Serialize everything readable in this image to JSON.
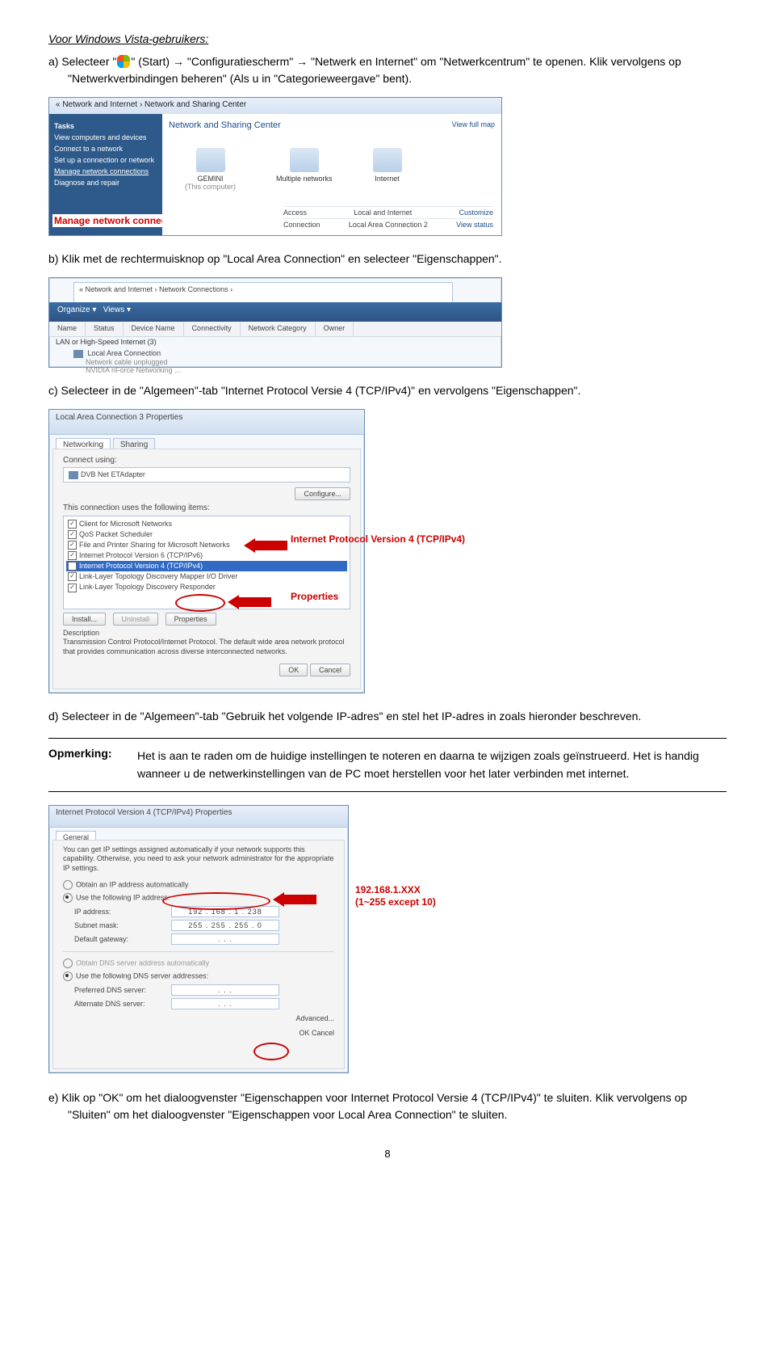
{
  "title_vista": "Voor Windows Vista-gebruikers:",
  "step_a_pre": "a)  Selecteer \"",
  "step_a_post": "\" (Start) → \"Configuratiescherm\" → \"Netwerk en Internet\" om \"Netwerkcentrum\" te openen. Klik vervolgens op \"Netwerkverbindingen beheren\" (Als u in \"Categorieweergave\" bent).",
  "step_b": "b)  Klik met de rechtermuisknop op \"Local Area Connection\" en selecteer \"Eigenschappen\".",
  "step_c": "c)  Selecteer in de \"Algemeen\"-tab \"Internet Protocol Versie 4 (TCP/IPv4)\" en vervolgens \"Eigenschappen\".",
  "step_d": "d)  Selecteer in de \"Algemeen\"-tab \"Gebruik het volgende IP-adres\" en stel het IP-adres in zoals hieronder beschreven.",
  "step_e": "e)  Klik op \"OK\" om het dialoogvenster \"Eigenschappen voor Internet Protocol Versie 4 (TCP/IPv4)\" te sluiten. Klik vervolgens op \"Sluiten\" om het dialoogvenster \"Eigenschappen voor Local Area Connection\" te sluiten.",
  "note_label": "Opmerking:",
  "note_text": "Het is aan te raden om de huidige instellingen te noteren en daarna te wijzigen zoals geïnstrueerd. Het is handig wanneer u de netwerkinstellingen van de PC moet herstellen voor het later verbinden met internet.",
  "page_num": "8",
  "ss1": {
    "breadcrumb": "« Network and Internet  ›  Network and Sharing Center",
    "tasks_h": "Tasks",
    "task1": "View computers and devices",
    "task2": "Connect to a network",
    "task3": "Set up a connection or network",
    "task4": "Manage network connections",
    "task5": "Diagnose and repair",
    "label_mnc": "Manage network connections",
    "title": "Network and Sharing Center",
    "viewmap": "View full map",
    "icon1": "GEMINI",
    "icon1b": "(This computer)",
    "icon2": "Multiple networks",
    "icon3": "Internet",
    "row1a": "Local and Internet",
    "row1b": "Customize",
    "row2a": "Access",
    "row2b": "Local Area Connection 2",
    "row2c": "View status",
    "row3a": "Connection"
  },
  "ss2": {
    "breadcrumb": "«  Network and Internet  ›  Network Connections  ›",
    "organize": "Organize ▾",
    "views": "Views ▾",
    "c1": "Name",
    "c2": "Status",
    "c3": "Device Name",
    "c4": "Connectivity",
    "c5": "Network Category",
    "c6": "Owner",
    "group": "LAN or High-Speed Internet (3)",
    "item_name": "Local Area Connection",
    "item_sub1": "Network cable unplugged",
    "item_sub2": "NVIDIA nForce Networking ..."
  },
  "ss3": {
    "title": "Local Area Connection 3 Properties",
    "tab1": "Networking",
    "tab2": "Sharing",
    "label_connect": "Connect using:",
    "adapter": "DVB Net ETAdapter",
    "configure": "Configure...",
    "label_uses": "This connection uses the following items:",
    "it1": "Client for Microsoft Networks",
    "it2": "QoS Packet Scheduler",
    "it3": "File and Printer Sharing for Microsoft Networks",
    "it4": "Internet Protocol Version 6 (TCP/IPv6)",
    "it5": "Internet Protocol Version 4 (TCP/IPv4)",
    "it6": "Link-Layer Topology Discovery Mapper I/O Driver",
    "it7": "Link-Layer Topology Discovery Responder",
    "install": "Install...",
    "uninstall": "Uninstall",
    "properties": "Properties",
    "desc_h": "Description",
    "desc": "Transmission Control Protocol/Internet Protocol. The default wide area network protocol that provides communication across diverse interconnected networks.",
    "ok": "OK",
    "cancel": "Cancel",
    "callout1": "Internet Protocol Version 4 (TCP/IPv4)",
    "callout2": "Properties"
  },
  "ss4": {
    "title": "Internet Protocol Version 4 (TCP/IPv4) Properties",
    "tab": "General",
    "intro": "You can get IP settings assigned automatically if your network supports this capability. Otherwise, you need to ask your network administrator for the appropriate IP settings.",
    "r1": "Obtain an IP address automatically",
    "r2": "Use the following IP address:",
    "f1": "IP address:",
    "v1": "192 . 168 .  1  . 238",
    "f2": "Subnet mask:",
    "v2": "255 . 255 . 255 .  0",
    "f3": "Default gateway:",
    "v3": " .       .       . ",
    "r3": "Obtain DNS server address automatically",
    "r4": "Use the following DNS server addresses:",
    "f4": "Preferred DNS server:",
    "v4": " .       .       . ",
    "f5": "Alternate DNS server:",
    "v5": " .       .       . ",
    "adv": "Advanced...",
    "ok": "OK",
    "cancel": "Cancel",
    "callout_ip": "192.168.1.XXX",
    "callout_range": "(1~255 except 10)"
  }
}
